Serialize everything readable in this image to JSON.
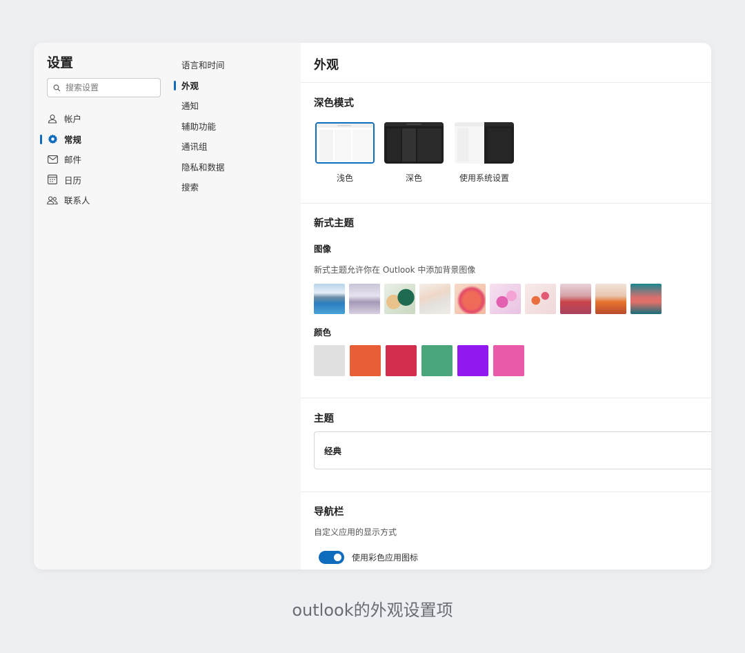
{
  "nav": {
    "title": "设置",
    "search_placeholder": "搜索设置",
    "items": [
      {
        "label": "帐户",
        "icon": "person-icon"
      },
      {
        "label": "常规",
        "icon": "gear-icon",
        "active": true
      },
      {
        "label": "邮件",
        "icon": "mail-icon"
      },
      {
        "label": "日历",
        "icon": "calendar-icon"
      },
      {
        "label": "联系人",
        "icon": "people-icon"
      }
    ]
  },
  "subnav": {
    "items": [
      {
        "label": "语言和时间"
      },
      {
        "label": "外观",
        "active": true
      },
      {
        "label": "通知"
      },
      {
        "label": "辅助功能"
      },
      {
        "label": "通讯组"
      },
      {
        "label": "隐私和数据"
      },
      {
        "label": "搜索"
      }
    ]
  },
  "content": {
    "title": "外观",
    "dark_mode": {
      "title": "深色模式",
      "options": [
        {
          "label": "浅色",
          "selected": true
        },
        {
          "label": "深色"
        },
        {
          "label": "使用系统设置"
        }
      ]
    },
    "new_theme": {
      "title": "新式主题",
      "image_title": "图像",
      "image_desc": "新式主题允许你在 Outlook 中添加背景图像",
      "color_title": "颜色",
      "colors": [
        "#e1e1e1",
        "#e85e36",
        "#d42e4f",
        "#4aa57a",
        "#9019f0",
        "#e95ba9"
      ]
    },
    "theme": {
      "title": "主题",
      "value": "经典"
    },
    "navbar": {
      "title": "导航栏",
      "desc": "自定义应用的显示方式",
      "toggle_label": "使用彩色应用图标",
      "toggle_on": true
    }
  },
  "accent": "#0f6cbd",
  "caption": "outlook的外观设置项"
}
